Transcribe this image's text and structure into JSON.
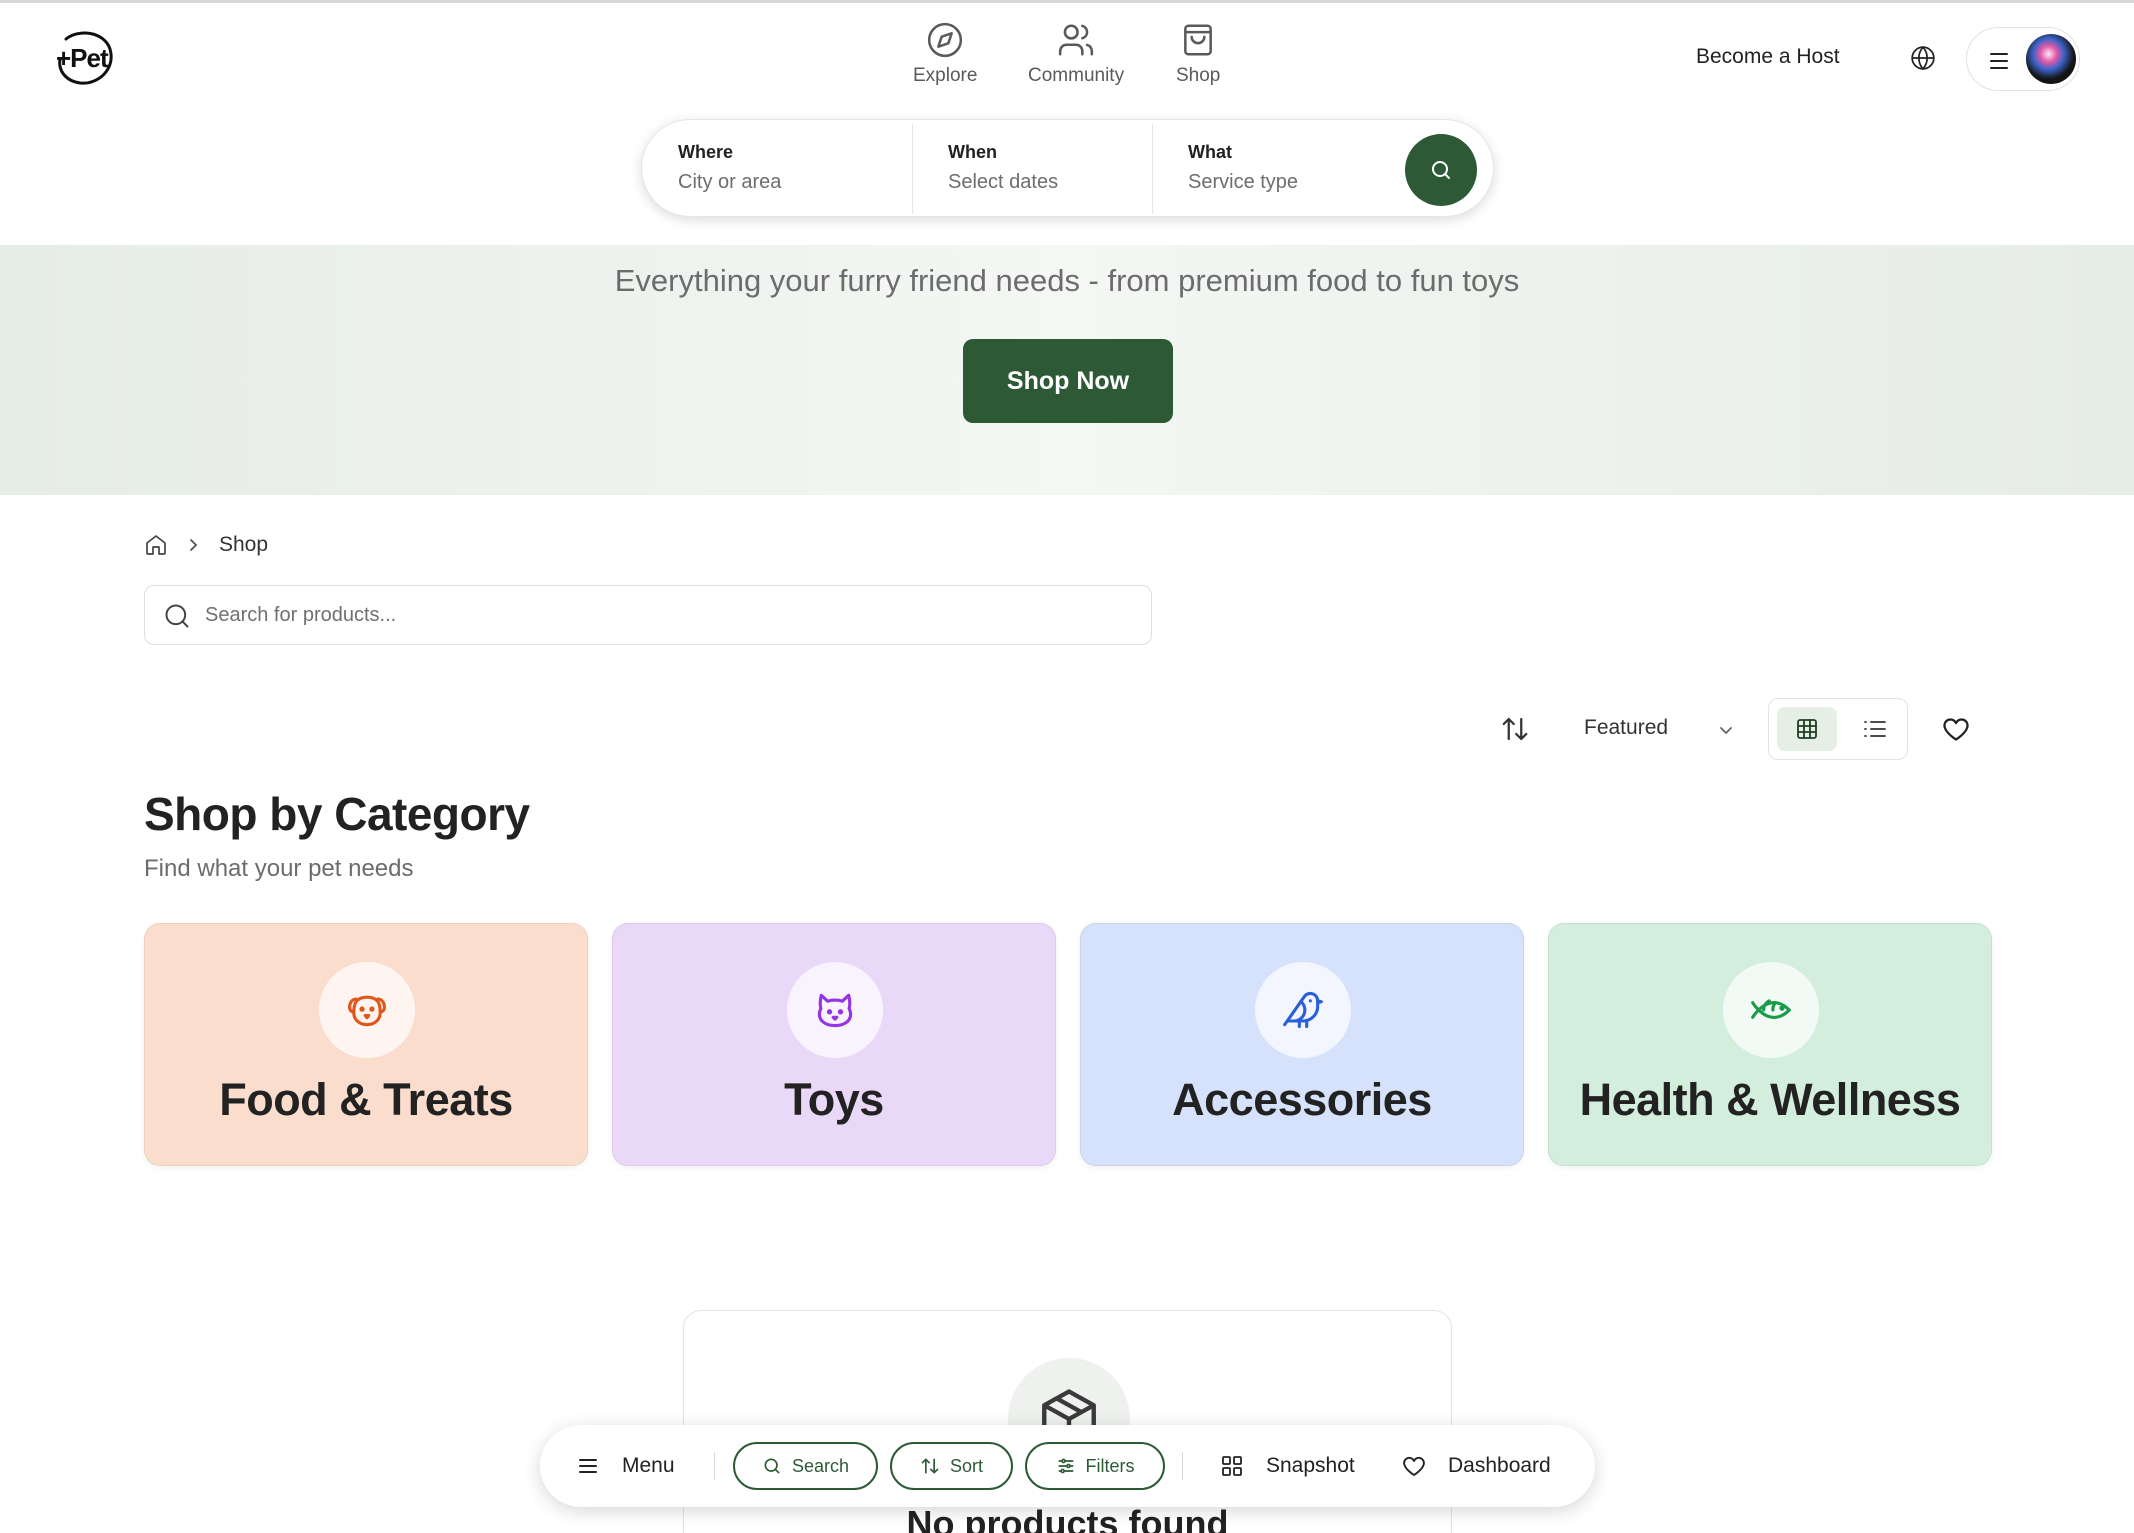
{
  "brand": {
    "logo_text": "+Pet"
  },
  "nav": [
    {
      "label": "Explore",
      "icon": "compass-icon"
    },
    {
      "label": "Community",
      "icon": "users-icon"
    },
    {
      "label": "Shop",
      "icon": "shopping-bag-icon"
    }
  ],
  "header": {
    "become_host": "Become a Host",
    "globe_icon": "globe-icon",
    "menu_icon": "hamburger-icon"
  },
  "search": {
    "where": {
      "label": "Where",
      "placeholder": "City or area"
    },
    "when": {
      "label": "When",
      "placeholder": "Select dates"
    },
    "what": {
      "label": "What",
      "placeholder": "Service type"
    }
  },
  "hero": {
    "subtitle": "Everything your furry friend needs - from premium food to fun toys",
    "cta": "Shop Now"
  },
  "breadcrumb": {
    "current": "Shop"
  },
  "product_search": {
    "placeholder": "Search for products..."
  },
  "toolbar": {
    "sort_value": "Featured"
  },
  "categories": {
    "title": "Shop by Category",
    "subtitle": "Find what your pet needs",
    "items": [
      {
        "label": "Food & Treats",
        "icon": "dog-icon",
        "bg": "#fbddcd",
        "accent": "#e0561d"
      },
      {
        "label": "Toys",
        "icon": "cat-icon",
        "bg": "#ead8f8",
        "accent": "#9334e6"
      },
      {
        "label": "Accessories",
        "icon": "bird-icon",
        "bg": "#d6e2fb",
        "accent": "#2b5fd9"
      },
      {
        "label": "Health & Wellness",
        "icon": "fish-icon",
        "bg": "#d3eedd",
        "accent": "#189c4a"
      }
    ]
  },
  "empty_state": {
    "title": "No products found",
    "icon": "package-icon"
  },
  "bottom_bar": {
    "menu": "Menu",
    "search": "Search",
    "sort": "Sort",
    "filters": "Filters",
    "snapshot": "Snapshot",
    "dashboard": "Dashboard"
  },
  "colors": {
    "brand_green": "#2d5a35"
  }
}
